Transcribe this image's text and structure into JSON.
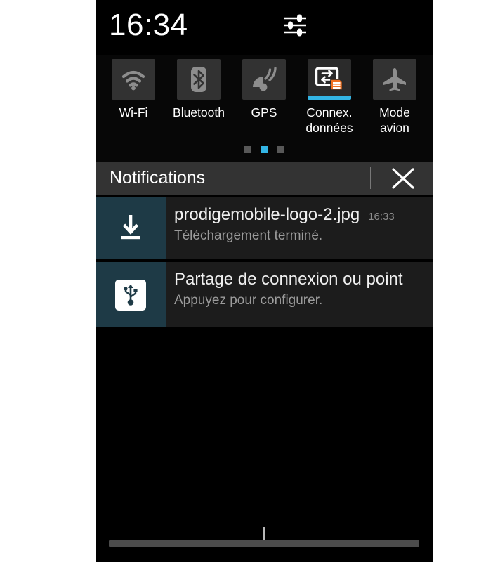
{
  "statusbar": {
    "clock": "16:34",
    "settings_icon": "sliders-settings-icon"
  },
  "quick_settings": {
    "toggles": [
      {
        "label": "Wi-Fi",
        "icon": "wifi-icon",
        "active": false
      },
      {
        "label": "Bluetooth",
        "icon": "bluetooth-icon",
        "active": false
      },
      {
        "label": "GPS",
        "icon": "gps-icon",
        "active": false
      },
      {
        "label": "Connex.\ndonnées",
        "icon": "mobile-data-icon",
        "active": true
      },
      {
        "label": "Mode\navion",
        "icon": "airplane-icon",
        "active": false
      }
    ],
    "page_dots": {
      "count": 3,
      "active_index": 1
    },
    "accent_color": "#33b5e5"
  },
  "notifications_panel": {
    "header_title": "Notifications",
    "close_icon": "close-x-icon",
    "icon_column_color": "#1e3a46",
    "items": [
      {
        "icon": "download-icon",
        "title": "prodigemobile-logo-2.jpg",
        "subtitle": "Téléchargement terminé.",
        "time": "16:33"
      },
      {
        "icon": "usb-icon",
        "title": "Partage de connexion ou point",
        "subtitle": "Appuyez pour configurer.",
        "time": ""
      }
    ]
  },
  "bottom": {
    "drag_handle": "shade-drag-handle"
  }
}
